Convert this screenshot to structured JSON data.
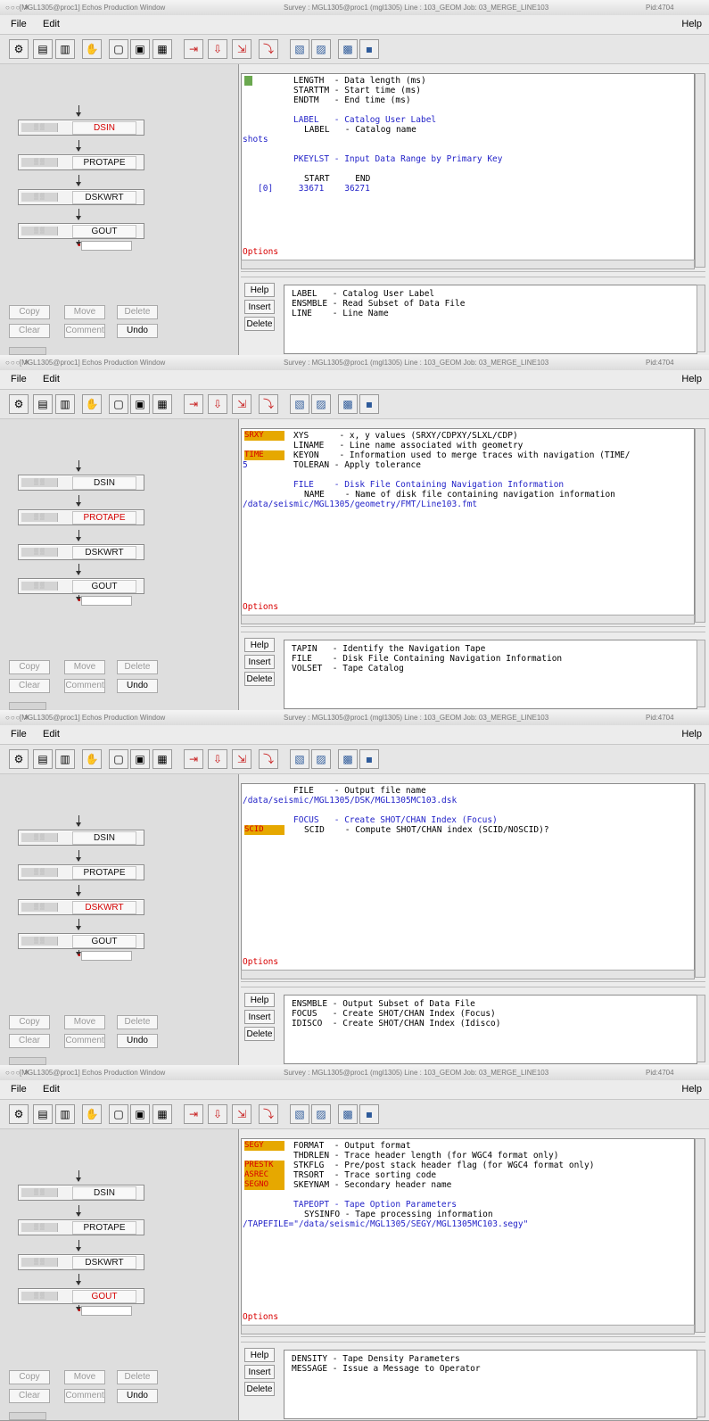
{
  "window": {
    "title_left": "[MGL1305@proc1] Echos Production Window",
    "title_mid": "Survey : MGL1305@proc1 (mgl1305)   Line : 103_GEOM   Job: 03_MERGE_LINE103",
    "pid": "Pid:4704"
  },
  "menu": {
    "file": "File",
    "edit": "Edit",
    "help": "Help"
  },
  "flow_modules": [
    "DSIN",
    "PROTAPE",
    "DSKWRT",
    "GOUT"
  ],
  "left_buttons": {
    "copy": "Copy",
    "move": "Move",
    "delete": "Delete",
    "clear": "Clear",
    "comment": "Comment",
    "undo": "Undo"
  },
  "side_buttons": {
    "help": "Help",
    "insert": "Insert",
    "delete": "Delete"
  },
  "options_label": "Options",
  "panels": [
    {
      "active": 0,
      "editor_lines": [
        {
          "t": "LENGTH  - Data length (ms)",
          "c": "k",
          "indent": 58,
          "row": 0
        },
        {
          "t": "STARTTM - Start time (ms)",
          "c": "k",
          "indent": 58,
          "row": 1
        },
        {
          "t": "ENDTM   - End time (ms)",
          "c": "k",
          "indent": 58,
          "row": 2
        },
        {
          "t": "LABEL   - Catalog User Label",
          "c": "b",
          "indent": 58,
          "row": 4
        },
        {
          "t": "LABEL   - Catalog name",
          "c": "k",
          "indent": 70,
          "row": 5
        },
        {
          "t": "shots",
          "c": "b",
          "indent": 1,
          "row": 6
        },
        {
          "t": "PKEYLST - Input Data Range by Primary Key",
          "c": "b",
          "indent": 58,
          "row": 8
        },
        {
          "t": "START     END",
          "c": "k",
          "indent": 70,
          "row": 10
        },
        {
          "t": "[0]     33671    36271",
          "c": "b",
          "indent": 18,
          "row": 11
        }
      ],
      "tags": [],
      "menu_lines": [
        "LABEL   - Catalog User Label",
        "ENSMBLE - Read Subset of Data File",
        "LINE    - Line Name"
      ]
    },
    {
      "active": 1,
      "editor_lines": [
        {
          "t": "XYS      - x, y values (SRXY/CDPXY/SLXL/CDP)",
          "c": "k",
          "indent": 58,
          "row": 0
        },
        {
          "t": "LINAME   - Line name associated with geometry",
          "c": "k",
          "indent": 58,
          "row": 1
        },
        {
          "t": "KEYON    - Information used to merge traces with navigation (TIME/",
          "c": "k",
          "indent": 58,
          "row": 2
        },
        {
          "t": "5",
          "c": "b",
          "indent": 1,
          "row": 3
        },
        {
          "t": "TOLERAN - Apply tolerance",
          "c": "k",
          "indent": 58,
          "row": 3
        },
        {
          "t": "FILE    - Disk File Containing Navigation Information",
          "c": "b",
          "indent": 58,
          "row": 5
        },
        {
          "t": "NAME    - Name of disk file containing navigation information",
          "c": "k",
          "indent": 70,
          "row": 6
        },
        {
          "t": "/data/seismic/MGL1305/geometry/FMT/Line103.fmt",
          "c": "b",
          "indent": 1,
          "row": 7
        }
      ],
      "tags": [
        {
          "t": "SRXY",
          "row": 0
        },
        {
          "t": "TIME",
          "row": 2
        }
      ],
      "menu_lines": [
        "TAPIN   - Identify the Navigation Tape",
        "FILE    - Disk File Containing Navigation Information",
        "VOLSET  - Tape Catalog"
      ]
    },
    {
      "active": 2,
      "editor_lines": [
        {
          "t": "FILE    - Output file name",
          "c": "k",
          "indent": 58,
          "row": 0
        },
        {
          "t": "/data/seismic/MGL1305/DSK/MGL1305MC103.dsk",
          "c": "b",
          "indent": 1,
          "row": 1
        },
        {
          "t": "FOCUS   - Create SHOT/CHAN Index (Focus)",
          "c": "b",
          "indent": 58,
          "row": 3
        },
        {
          "t": "SCID    - Compute SHOT/CHAN index (SCID/NOSCID)?",
          "c": "k",
          "indent": 70,
          "row": 4
        }
      ],
      "tags": [
        {
          "t": "SCID",
          "row": 4
        }
      ],
      "menu_lines": [
        "ENSMBLE - Output Subset of Data File",
        "FOCUS   - Create SHOT/CHAN Index (Focus)",
        "IDISCO  - Create SHOT/CHAN Index (Idisco)"
      ]
    },
    {
      "active": 3,
      "editor_lines": [
        {
          "t": "FORMAT  - Output format",
          "c": "k",
          "indent": 58,
          "row": 0
        },
        {
          "t": "THDRLEN - Trace header length (for WGC4 format only)",
          "c": "k",
          "indent": 58,
          "row": 1
        },
        {
          "t": "STKFLG  - Pre/post stack header flag (for WGC4 format only)",
          "c": "k",
          "indent": 58,
          "row": 2
        },
        {
          "t": "TRSORT  - Trace sorting code",
          "c": "k",
          "indent": 58,
          "row": 3
        },
        {
          "t": "SKEYNAM - Secondary header name",
          "c": "k",
          "indent": 58,
          "row": 4
        },
        {
          "t": "TAPEOPT - Tape Option Parameters",
          "c": "b",
          "indent": 58,
          "row": 6
        },
        {
          "t": "SYSINFO - Tape processing information",
          "c": "k",
          "indent": 70,
          "row": 7
        },
        {
          "t": "/TAPEFILE=\"/data/seismic/MGL1305/SEGY/MGL1305MC103.segy\"",
          "c": "b",
          "indent": 1,
          "row": 8
        }
      ],
      "tags": [
        {
          "t": "SEGY",
          "row": 0
        },
        {
          "t": "PRESTK",
          "row": 2
        },
        {
          "t": "ASREC",
          "row": 3
        },
        {
          "t": "SEGNO",
          "row": 4
        }
      ],
      "menu_lines": [
        "DENSITY - Tape Density Parameters",
        "MESSAGE - Issue a Message to Operator"
      ]
    }
  ]
}
